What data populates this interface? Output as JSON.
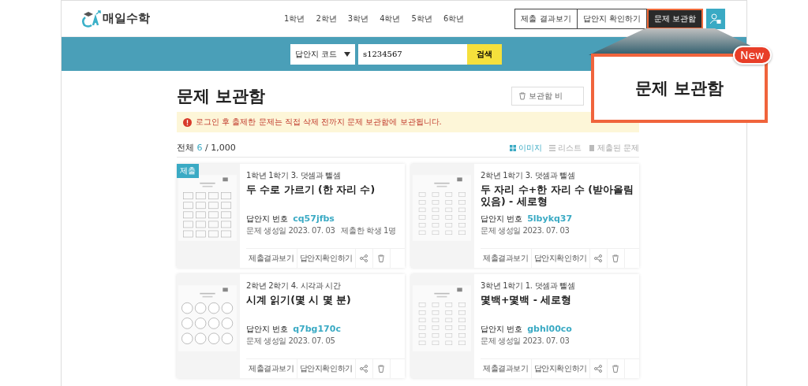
{
  "header": {
    "logo": "매일수학",
    "grades": [
      {
        "label": "1학년"
      },
      {
        "label": "2학년"
      },
      {
        "label": "3학년"
      },
      {
        "label": "4학년"
      },
      {
        "label": "5학년"
      },
      {
        "label": "6학년"
      }
    ],
    "actions": [
      {
        "label": "제출 결과보기",
        "selected": false
      },
      {
        "label": "답안지 확인하기",
        "selected": false
      },
      {
        "label": "문제 보관함",
        "selected": true
      }
    ]
  },
  "search": {
    "select": "답안지 코드",
    "value": "s1234567",
    "button": "검색"
  },
  "page": {
    "title": "문제 보관함",
    "clear_button": "보관함 비",
    "notice": "로그인 후 출제한 문제는 직접 삭제 전까지 문제 보관함에 보관됩니다.",
    "total_label": "전체",
    "count": "6",
    "limit": "/ 1,000",
    "views": [
      {
        "label": "이미지",
        "selected": true
      },
      {
        "label": "리스트",
        "selected": false
      },
      {
        "label": "제출된 문제",
        "selected": false
      }
    ]
  },
  "cards": [
    {
      "badge": "제출",
      "thumbnail": {
        "kind": "boxes"
      },
      "unit": "1학년 1학기 3. 덧셈과 뺄셈",
      "title": "두 수로 가르기 (한 자리 수)",
      "code_label": "답안지 번호",
      "code": "cq57jfbs",
      "date": "문제 생성일 2023. 07. 03",
      "submitted": "제출한 학생 1명",
      "buttons": [
        "제출결과보기",
        "답안지확인하기"
      ]
    },
    {
      "thumbnail": {
        "kind": "columns"
      },
      "unit": "2학년 1학기 3. 덧셈과 뺄셈",
      "title": "두 자리 수+한 자리 수 (받아올림 있음) - 세로형",
      "code_label": "답안지 번호",
      "code": "5lbykq37",
      "date": "문제 생성일 2023. 07. 03",
      "buttons": [
        "제출결과보기",
        "답안지확인하기"
      ]
    },
    {
      "thumbnail": {
        "kind": "clocks"
      },
      "unit": "2학년 2학기 4. 시각과 시간",
      "title": "시계 읽기(몇 시 몇 분)",
      "code_label": "답안지 번호",
      "code": "q7bg170c",
      "date": "문제 생성일 2023. 07. 05",
      "buttons": [
        "제출결과보기",
        "답안지확인하기"
      ]
    },
    {
      "thumbnail": {
        "kind": "columns"
      },
      "unit": "3학년 1학기 1. 덧셈과 뺄셈",
      "title": "몇백+몇백 - 세로형",
      "code_label": "답안지 번호",
      "code": "gbhl00co",
      "date": "문제 생성일 2023. 07. 03",
      "buttons": [
        "제출결과보기",
        "답안지확인하기"
      ]
    }
  ],
  "callout": {
    "badge": "New",
    "text": "문제 보관함"
  }
}
